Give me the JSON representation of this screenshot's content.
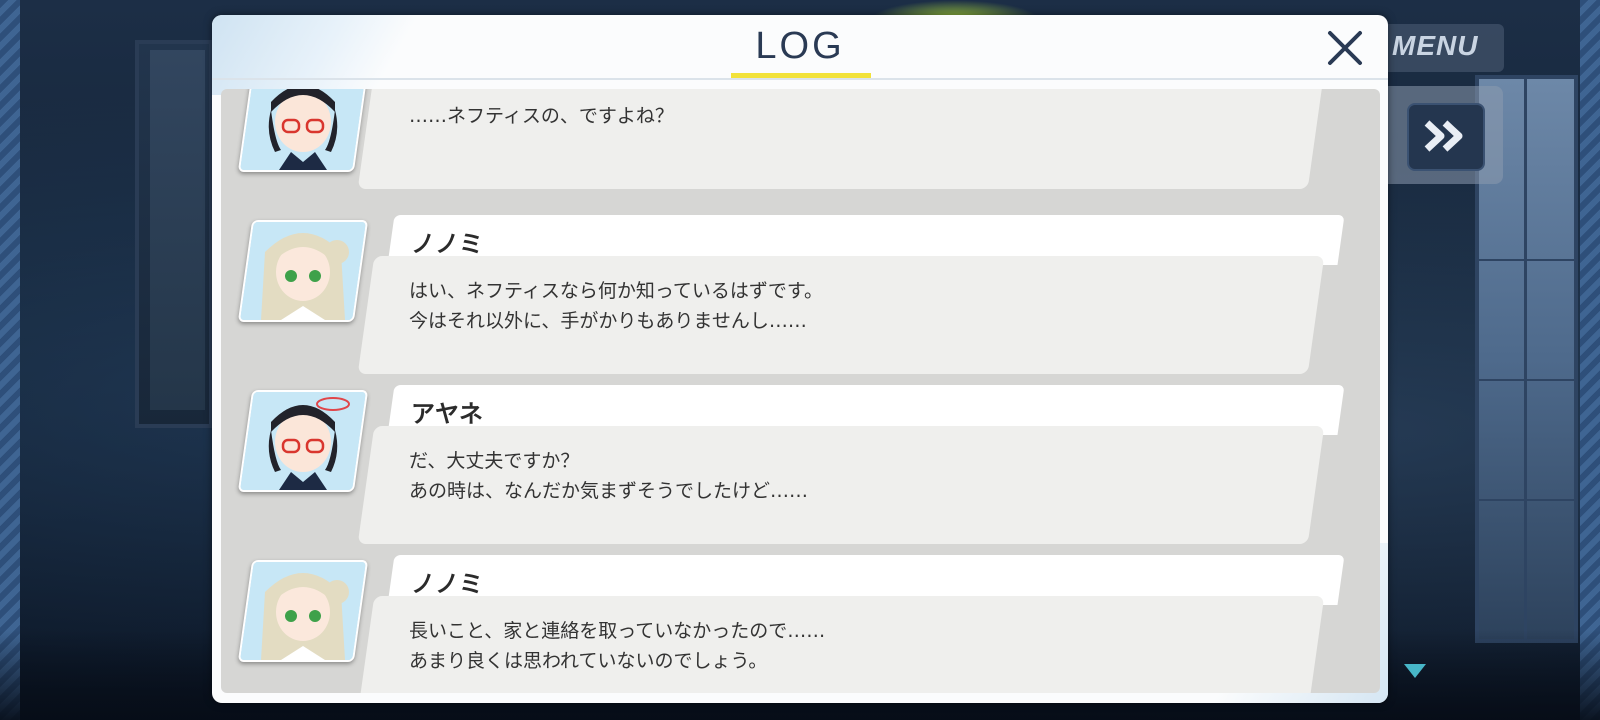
{
  "header": {
    "title": "LOG"
  },
  "menu": {
    "label": "MENU"
  },
  "entries": [
    {
      "character": "アヤネ",
      "show_name": false,
      "lines": [
        "……ネフティスの、ですよね？"
      ]
    },
    {
      "character": "ノノミ",
      "show_name": true,
      "lines": [
        "はい、ネフティスなら何か知っているはずです。",
        "今はそれ以外に、手がかりもありませんし……"
      ]
    },
    {
      "character": "アヤネ",
      "show_name": true,
      "lines": [
        "だ、大丈夫ですか？",
        "あの時は、なんだか気まずそうでしたけど……"
      ]
    },
    {
      "character": "ノノミ",
      "show_name": true,
      "lines": [
        "長いこと、家と連絡を取っていなかったので……",
        "あまり良くは思われていないのでしょう。"
      ]
    }
  ],
  "icons": {
    "close": "close-icon",
    "fast_forward": "fast-forward-icon",
    "scroll": "scroll-down-icon"
  },
  "colors": {
    "title": "#2a3a54",
    "accent": "#f2e23a",
    "panel": "#fbfcfd",
    "log_bg": "#d6d6d4",
    "bubble": "#efefed"
  }
}
